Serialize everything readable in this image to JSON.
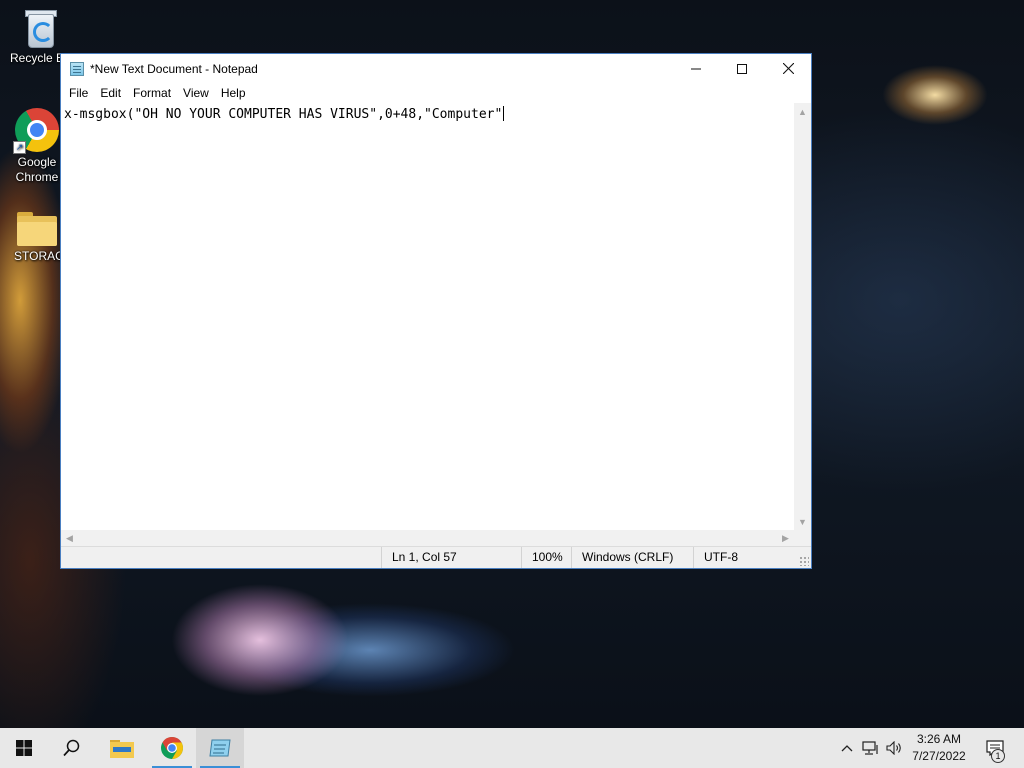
{
  "desktop": {
    "icons": [
      {
        "label": "Recycle Bin",
        "icon": "recycle-bin-icon"
      },
      {
        "label": "Google Chrome",
        "icon": "chrome-icon"
      },
      {
        "label": "STORAGE",
        "icon": "folder-icon"
      }
    ]
  },
  "notepad": {
    "title": "*New Text Document - Notepad",
    "menu": [
      "File",
      "Edit",
      "Format",
      "View",
      "Help"
    ],
    "content": "x-msgbox(\"OH NO YOUR COMPUTER HAS VIRUS\",0+48,\"Computer\"",
    "status": {
      "position": "Ln 1, Col 57",
      "zoom": "100%",
      "line_ending": "Windows (CRLF)",
      "encoding": "UTF-8"
    }
  },
  "taskbar": {
    "apps": [
      "start-icon",
      "search-icon",
      "file-explorer-icon",
      "chrome-icon",
      "notepad-icon"
    ],
    "clock": {
      "time": "3:26 AM",
      "date": "7/27/2022"
    },
    "notification_count": "1"
  },
  "colors": {
    "window_border": "#4a7fc1",
    "taskbar_bg": "#e8e8e8",
    "active_indicator": "#3b8fd6"
  }
}
